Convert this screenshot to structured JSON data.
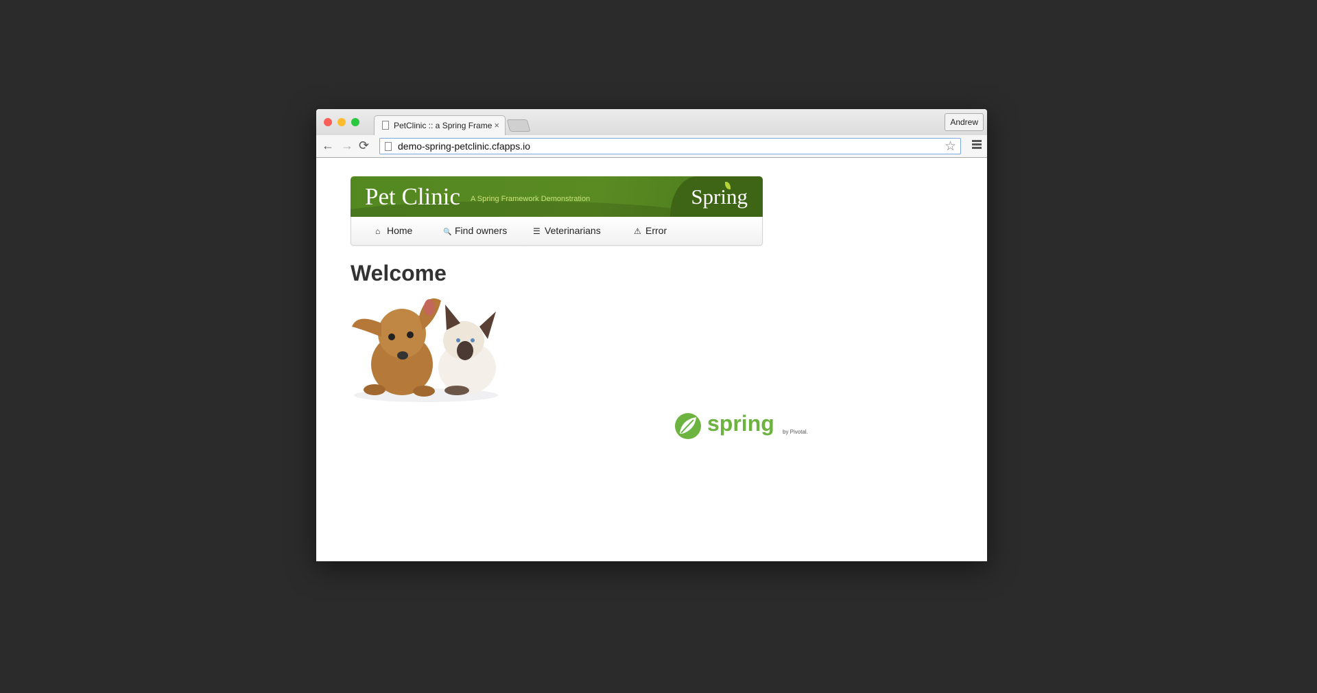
{
  "browser": {
    "tab_title": "PetClinic :: a Spring Frame",
    "close_glyph": "×",
    "user": "Andrew",
    "url": "demo-spring-petclinic.cfapps.io",
    "back": "←",
    "forward": "→",
    "reload": "⟳",
    "star": "☆"
  },
  "header": {
    "title": "Pet Clinic",
    "tagline": "A Spring Framework Demonstration",
    "brand": "Spring"
  },
  "nav": {
    "items": [
      {
        "label": "Home",
        "icon": "home-icon",
        "glyph": "⌂"
      },
      {
        "label": "Find owners",
        "icon": "search-icon",
        "glyph": "🔍"
      },
      {
        "label": "Veterinarians",
        "icon": "list-icon",
        "glyph": "☰"
      },
      {
        "label": "Error",
        "icon": "warning-icon",
        "glyph": "⚠"
      }
    ]
  },
  "main": {
    "heading": "Welcome"
  },
  "footer": {
    "logo_text": "spring",
    "logo_by": "by Pivotal."
  },
  "colors": {
    "banner_green": "#538821",
    "spring_green": "#6db33f",
    "text": "#333333"
  }
}
